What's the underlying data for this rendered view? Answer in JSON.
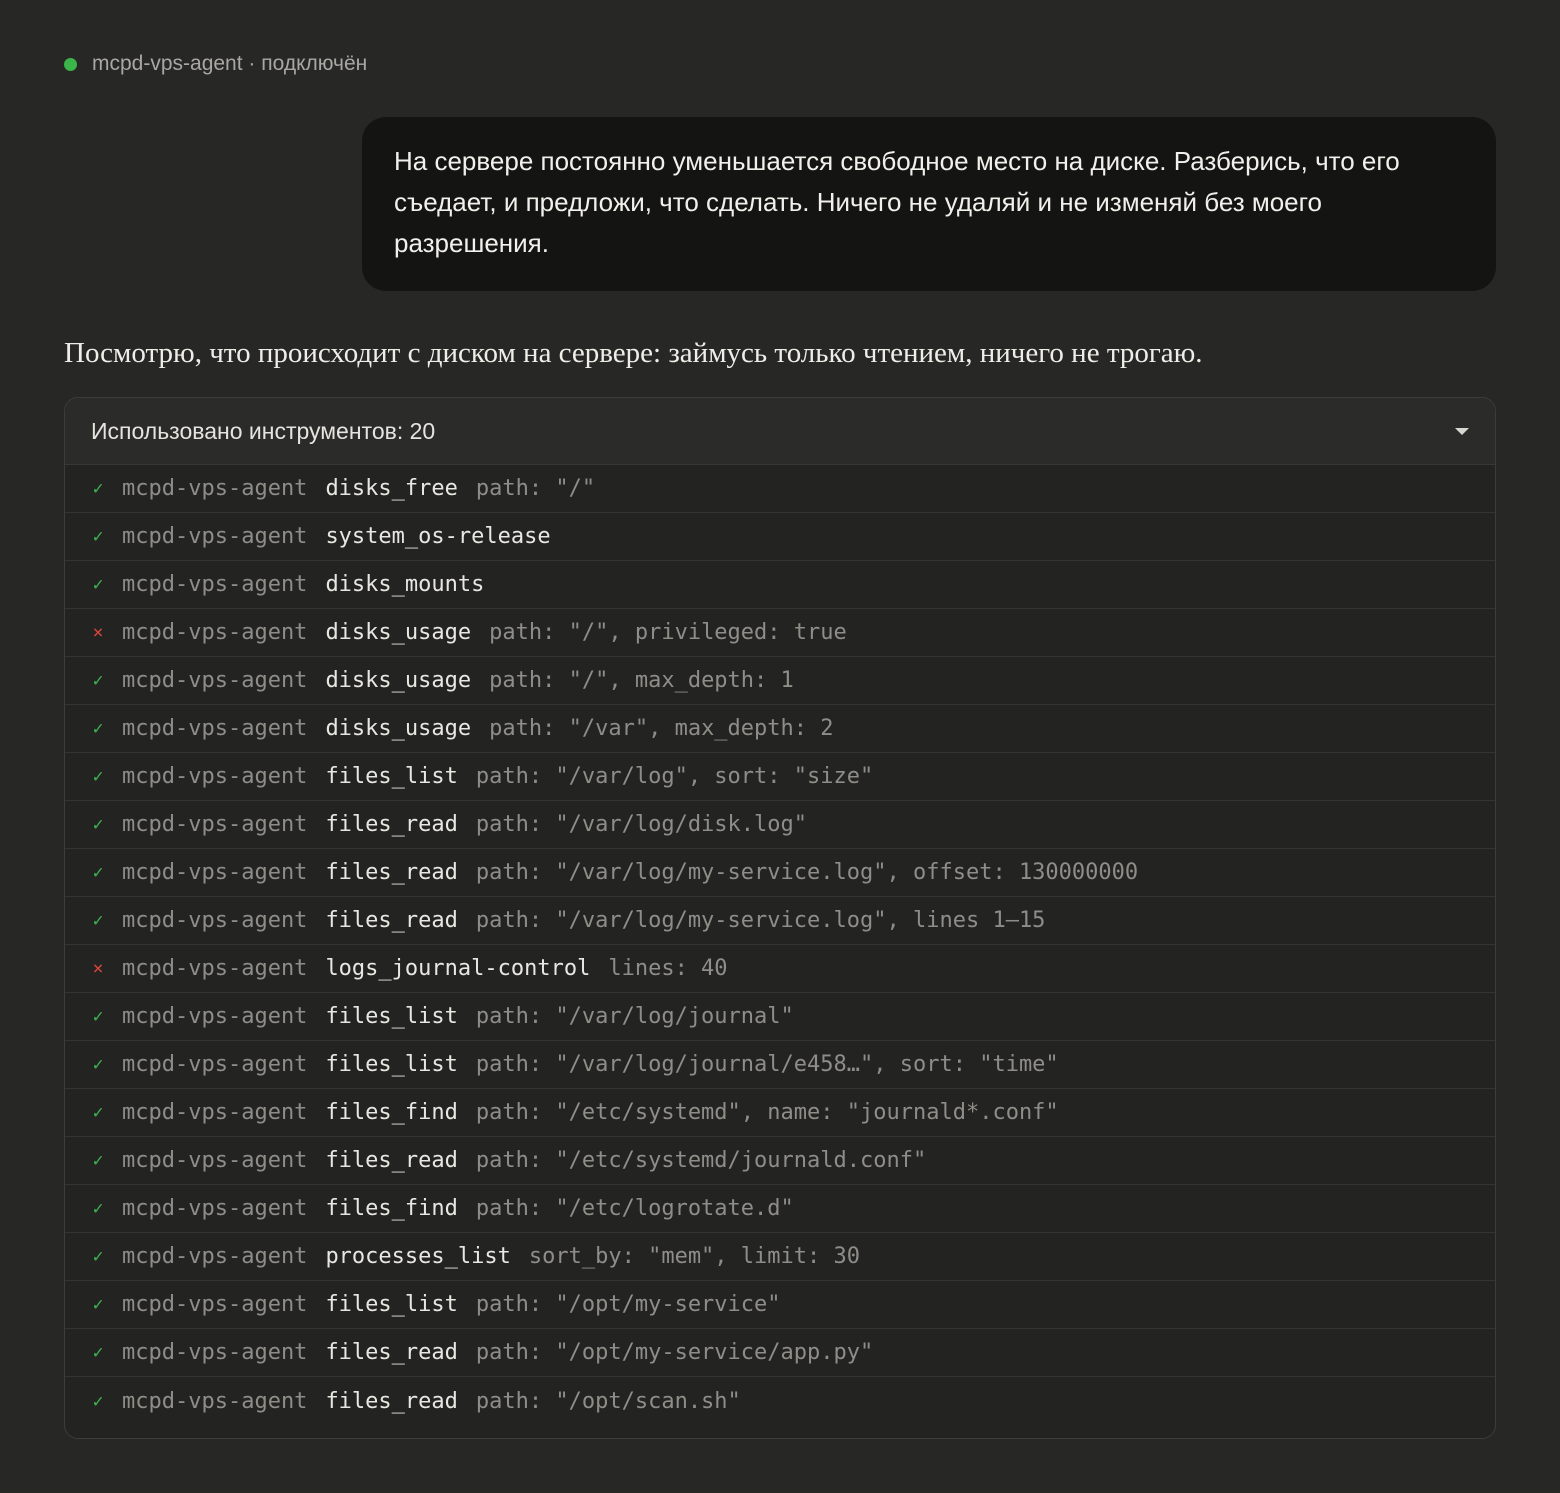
{
  "connection": {
    "label": "mcpd-vps-agent · подключён",
    "status_color": "#3bb54a"
  },
  "user_message": "На сервере постоянно уменьшается свободное место на диске. Разберись, что его съедает, и предложи, что сделать. Ничего не удаляй и не изменяй без моего разрешения.",
  "assistant_message": "Посмотрю, что происходит с диском на сервере: займусь только чтением, ничего не трогаю.",
  "tools_panel": {
    "header": "Использовано инструментов: 20",
    "expand_icon": "chevron-down-icon",
    "success_icon_glyph": "✓",
    "error_icon_glyph": "×",
    "items": [
      {
        "status": "ok",
        "server": "mcpd-vps-agent",
        "tool": "disks_free",
        "args": "path: \"/\""
      },
      {
        "status": "ok",
        "server": "mcpd-vps-agent",
        "tool": "system_os-release",
        "args": ""
      },
      {
        "status": "ok",
        "server": "mcpd-vps-agent",
        "tool": "disks_mounts",
        "args": ""
      },
      {
        "status": "error",
        "server": "mcpd-vps-agent",
        "tool": "disks_usage",
        "args": "path: \"/\", privileged: true"
      },
      {
        "status": "ok",
        "server": "mcpd-vps-agent",
        "tool": "disks_usage",
        "args": "path: \"/\", max_depth: 1"
      },
      {
        "status": "ok",
        "server": "mcpd-vps-agent",
        "tool": "disks_usage",
        "args": "path: \"/var\", max_depth: 2"
      },
      {
        "status": "ok",
        "server": "mcpd-vps-agent",
        "tool": "files_list",
        "args": "path: \"/var/log\", sort: \"size\""
      },
      {
        "status": "ok",
        "server": "mcpd-vps-agent",
        "tool": "files_read",
        "args": "path: \"/var/log/disk.log\""
      },
      {
        "status": "ok",
        "server": "mcpd-vps-agent",
        "tool": "files_read",
        "args": "path: \"/var/log/my-service.log\", offset: 130000000"
      },
      {
        "status": "ok",
        "server": "mcpd-vps-agent",
        "tool": "files_read",
        "args": "path: \"/var/log/my-service.log\", lines 1–15"
      },
      {
        "status": "error",
        "server": "mcpd-vps-agent",
        "tool": "logs_journal-control",
        "args": "lines: 40"
      },
      {
        "status": "ok",
        "server": "mcpd-vps-agent",
        "tool": "files_list",
        "args": "path: \"/var/log/journal\""
      },
      {
        "status": "ok",
        "server": "mcpd-vps-agent",
        "tool": "files_list",
        "args": "path: \"/var/log/journal/e458…\", sort: \"time\""
      },
      {
        "status": "ok",
        "server": "mcpd-vps-agent",
        "tool": "files_find",
        "args": "path: \"/etc/systemd\", name: \"journald*.conf\""
      },
      {
        "status": "ok",
        "server": "mcpd-vps-agent",
        "tool": "files_read",
        "args": "path: \"/etc/systemd/journald.conf\""
      },
      {
        "status": "ok",
        "server": "mcpd-vps-agent",
        "tool": "files_find",
        "args": "path: \"/etc/logrotate.d\""
      },
      {
        "status": "ok",
        "server": "mcpd-vps-agent",
        "tool": "processes_list",
        "args": "sort_by: \"mem\", limit: 30"
      },
      {
        "status": "ok",
        "server": "mcpd-vps-agent",
        "tool": "files_list",
        "args": "path: \"/opt/my-service\""
      },
      {
        "status": "ok",
        "server": "mcpd-vps-agent",
        "tool": "files_read",
        "args": "path: \"/opt/my-service/app.py\""
      },
      {
        "status": "ok",
        "server": "mcpd-vps-agent",
        "tool": "files_read",
        "args": "path: \"/opt/scan.sh\""
      }
    ]
  }
}
